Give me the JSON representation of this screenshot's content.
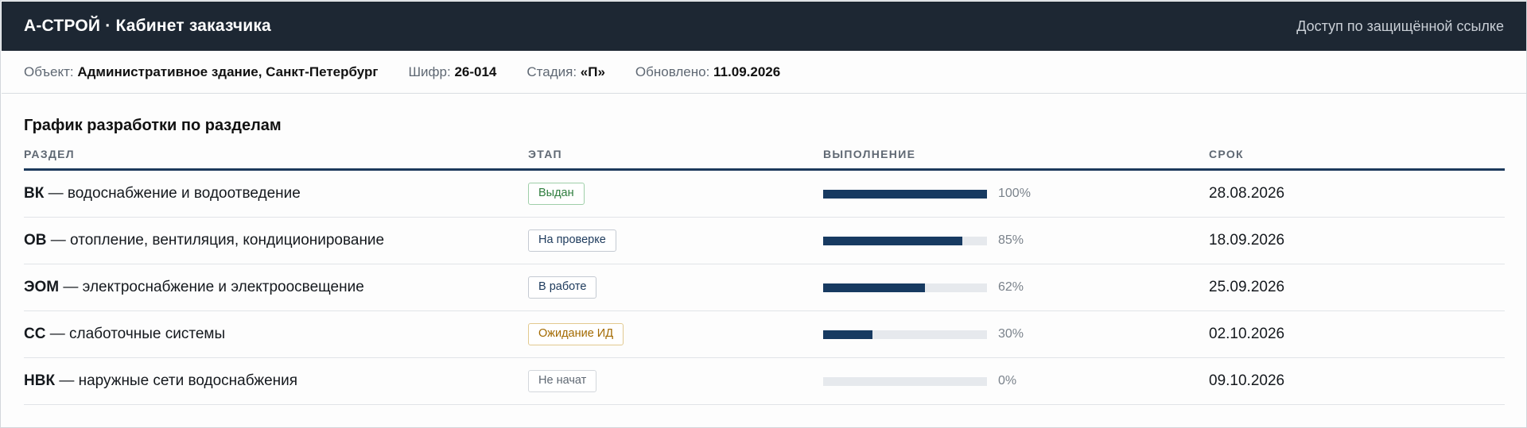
{
  "header": {
    "title": "А-СТРОЙ · Кабинет заказчика",
    "access_link": "Доступ по защищённой ссылке"
  },
  "meta": {
    "object_label": "Объект:",
    "object_value": "Административное здание, Санкт-Петербург",
    "code_label": "Шифр:",
    "code_value": "26-014",
    "stage_label": "Стадия:",
    "stage_value": "«П»",
    "updated_label": "Обновлено:",
    "updated_value": "11.09.2026"
  },
  "schedule": {
    "title": "График разработки по разделам",
    "columns": [
      "РАЗДЕЛ",
      "ЭТАП",
      "ВЫПОЛНЕНИЕ",
      "СРОК"
    ],
    "rows": [
      {
        "code": "ВК",
        "name": " — водоснабжение и водоотведение",
        "stage": "Выдан",
        "stage_color": "#2e7d3e",
        "stage_border": "#9fcfa9",
        "progress": 100,
        "progress_label": "100%",
        "deadline": "28.08.2026"
      },
      {
        "code": "ОВ",
        "name": " — отопление, вентиляция, кондиционирование",
        "stage": "На проверке",
        "stage_color": "#1d3a5c",
        "stage_border": "#c4cad2",
        "progress": 85,
        "progress_label": "85%",
        "deadline": "18.09.2026"
      },
      {
        "code": "ЭОМ",
        "name": " — электроснабжение и электроосвещение",
        "stage": "В работе",
        "stage_color": "#1d3a5c",
        "stage_border": "#c4cad2",
        "progress": 62,
        "progress_label": "62%",
        "deadline": "25.09.2026"
      },
      {
        "code": "СС",
        "name": " — слаботочные системы",
        "stage": "Ожидание ИД",
        "stage_color": "#a36a00",
        "stage_border": "#e2c98f",
        "progress": 30,
        "progress_label": "30%",
        "deadline": "02.10.2026"
      },
      {
        "code": "НВК",
        "name": " — наружные сети водоснабжения",
        "stage": "Не начат",
        "stage_color": "#5f6873",
        "stage_border": "#d3d7dc",
        "progress": 0,
        "progress_label": "0%",
        "deadline": "09.10.2026"
      }
    ]
  }
}
